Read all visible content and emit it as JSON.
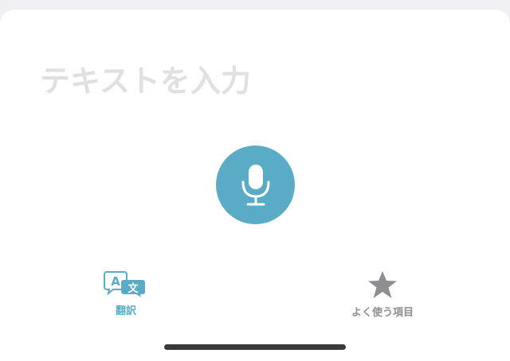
{
  "input": {
    "placeholder": "テキストを入力",
    "value": ""
  },
  "mic_button": {
    "icon": "microphone-icon",
    "color": "#5aacc6"
  },
  "tabs": [
    {
      "label": "翻訳",
      "icon": "translate-icon",
      "active": true,
      "color": "#5aacc6"
    },
    {
      "label": "よく使う項目",
      "icon": "star-icon",
      "active": false,
      "color": "#8e8e93"
    }
  ]
}
